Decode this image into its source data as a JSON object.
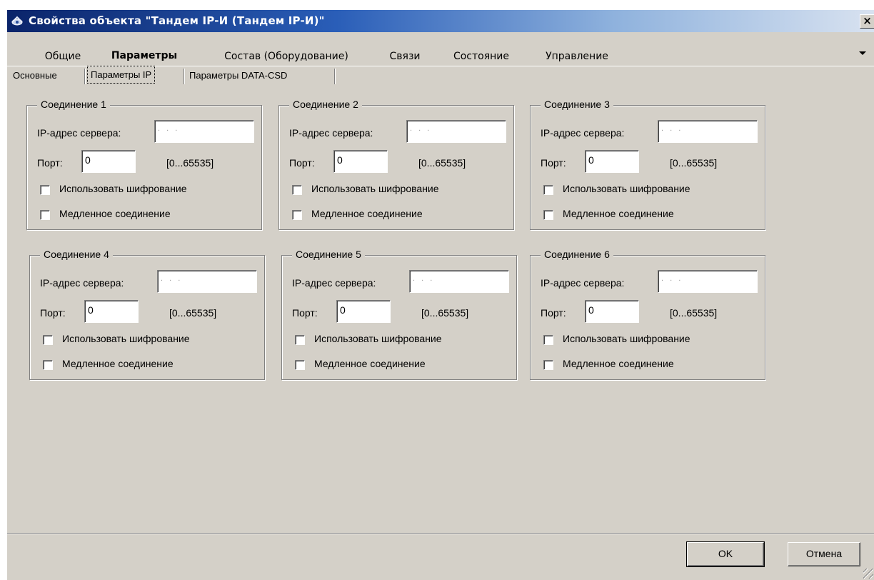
{
  "window": {
    "title": "Свойства объекта \"Тандем IP-И (Тандем IP-И)\"",
    "close_label": "×"
  },
  "main_tabs": [
    {
      "label": "Общие"
    },
    {
      "label": "Параметры"
    },
    {
      "label": "Состав (Оборудование)"
    },
    {
      "label": "Связи"
    },
    {
      "label": "Состояние"
    },
    {
      "label": "Управление"
    }
  ],
  "active_main_tab": "Параметры",
  "sub_tabs": [
    {
      "label": "Основные"
    },
    {
      "label": "Параметры IP"
    },
    {
      "label": "Параметры DATA-CSD"
    }
  ],
  "active_sub_tab": "Параметры IP",
  "connections": [
    {
      "title": "Соединение 1",
      "ip_label": "IP-адрес сервера:",
      "ip_value": ". . .",
      "port_label": "Порт:",
      "port_value": "0",
      "port_range": "[0...65535]",
      "encrypt_label": "Использовать шифрование",
      "encrypt_checked": false,
      "slow_label": "Медленное соединение",
      "slow_checked": false
    },
    {
      "title": "Соединение 2",
      "ip_label": "IP-адрес сервера:",
      "ip_value": ". . .",
      "port_label": "Порт:",
      "port_value": "0",
      "port_range": "[0...65535]",
      "encrypt_label": "Использовать шифрование",
      "encrypt_checked": false,
      "slow_label": "Медленное соединение",
      "slow_checked": false
    },
    {
      "title": "Соединение 3",
      "ip_label": "IP-адрес сервера:",
      "ip_value": ". . .",
      "port_label": "Порт:",
      "port_value": "0",
      "port_range": "[0...65535]",
      "encrypt_label": "Использовать шифрование",
      "encrypt_checked": false,
      "slow_label": "Медленное соединение",
      "slow_checked": false
    },
    {
      "title": "Соединение 4",
      "ip_label": "IP-адрес сервера:",
      "ip_value": ". . .",
      "port_label": "Порт:",
      "port_value": "0",
      "port_range": "[0...65535]",
      "encrypt_label": "Использовать шифрование",
      "encrypt_checked": false,
      "slow_label": "Медленное соединение",
      "slow_checked": false
    },
    {
      "title": "Соединение 5",
      "ip_label": "IP-адрес сервера:",
      "ip_value": ". . .",
      "port_label": "Порт:",
      "port_value": "0",
      "port_range": "[0...65535]",
      "encrypt_label": "Использовать шифрование",
      "encrypt_checked": false,
      "slow_label": "Медленное соединение",
      "slow_checked": false
    },
    {
      "title": "Соединение 6",
      "ip_label": "IP-адрес сервера:",
      "ip_value": ". . .",
      "port_label": "Порт:",
      "port_value": "0",
      "port_range": "[0...65535]",
      "encrypt_label": "Использовать шифрование",
      "encrypt_checked": false,
      "slow_label": "Медленное соединение",
      "slow_checked": false
    }
  ],
  "buttons": {
    "ok_label": "OK",
    "cancel_label": "Отмена"
  },
  "icons": {
    "title_icon": "object-properties-icon",
    "tabs_menu_icon": "chevron-down-icon"
  },
  "colors": {
    "titlebar_start": "#0a246a",
    "titlebar_end": "#d8e2f0",
    "face": "#d4d0c8"
  }
}
